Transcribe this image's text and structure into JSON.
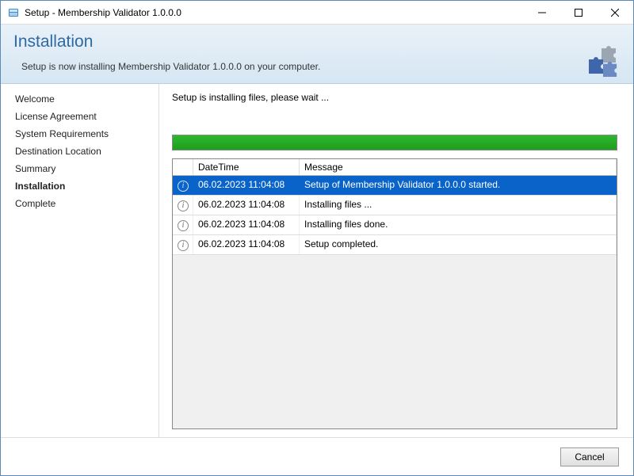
{
  "window": {
    "title": "Setup - Membership Validator 1.0.0.0"
  },
  "header": {
    "title": "Installation",
    "subtitle": "Setup is now installing Membership Validator 1.0.0.0 on your computer."
  },
  "sidebar": {
    "items": [
      {
        "label": "Welcome",
        "active": false
      },
      {
        "label": "License Agreement",
        "active": false
      },
      {
        "label": "System Requirements",
        "active": false
      },
      {
        "label": "Destination Location",
        "active": false
      },
      {
        "label": "Summary",
        "active": false
      },
      {
        "label": "Installation",
        "active": true
      },
      {
        "label": "Complete",
        "active": false
      }
    ]
  },
  "content": {
    "status": "Setup is installing files, please wait ...",
    "progress_percent": 100
  },
  "log": {
    "columns": {
      "datetime": "DateTime",
      "message": "Message"
    },
    "rows": [
      {
        "datetime": "06.02.2023 11:04:08",
        "message": "Setup of Membership Validator 1.0.0.0 started.",
        "selected": true
      },
      {
        "datetime": "06.02.2023 11:04:08",
        "message": "Installing files ...",
        "selected": false
      },
      {
        "datetime": "06.02.2023 11:04:08",
        "message": "Installing files done.",
        "selected": false
      },
      {
        "datetime": "06.02.2023 11:04:08",
        "message": "Setup completed.",
        "selected": false
      }
    ]
  },
  "footer": {
    "cancel_label": "Cancel"
  }
}
